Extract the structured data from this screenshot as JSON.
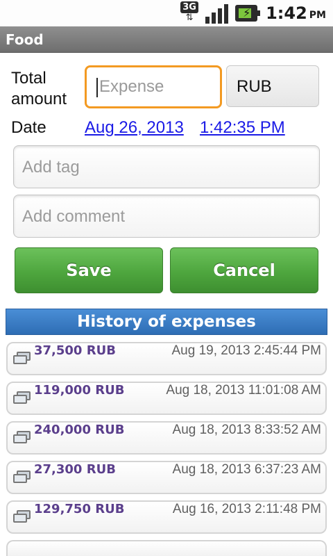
{
  "status_bar": {
    "network": "3G",
    "time": "1:42",
    "ampm": "PM"
  },
  "title_bar": {
    "title": "Food"
  },
  "form": {
    "total_label_line1": "Total",
    "total_label_line2": "amount",
    "expense_placeholder": "Expense",
    "currency": "RUB",
    "date_label": "Date",
    "date_value": "Aug 26, 2013",
    "time_value": "1:42:35 PM",
    "tag_placeholder": "Add tag",
    "comment_placeholder": "Add comment",
    "save_label": "Save",
    "cancel_label": "Cancel"
  },
  "history": {
    "header": "History of expenses",
    "items": [
      {
        "amount": "37,500 RUB",
        "date": "Aug 19, 2013 2:45:44 PM"
      },
      {
        "amount": "119,000 RUB",
        "date": "Aug 18, 2013 11:01:08 AM"
      },
      {
        "amount": "240,000 RUB",
        "date": "Aug 18, 2013 8:33:52 AM"
      },
      {
        "amount": "27,300 RUB",
        "date": "Aug 18, 2013 6:37:23 AM"
      },
      {
        "amount": "129,750 RUB",
        "date": "Aug 16, 2013 2:11:48 PM"
      }
    ]
  },
  "colors": {
    "accent_focus": "#f39a22",
    "button_green": "#4ea63e",
    "header_blue": "#2e6db4",
    "amount_purple": "#5b3f8c",
    "link_blue": "#1a1ae6"
  }
}
